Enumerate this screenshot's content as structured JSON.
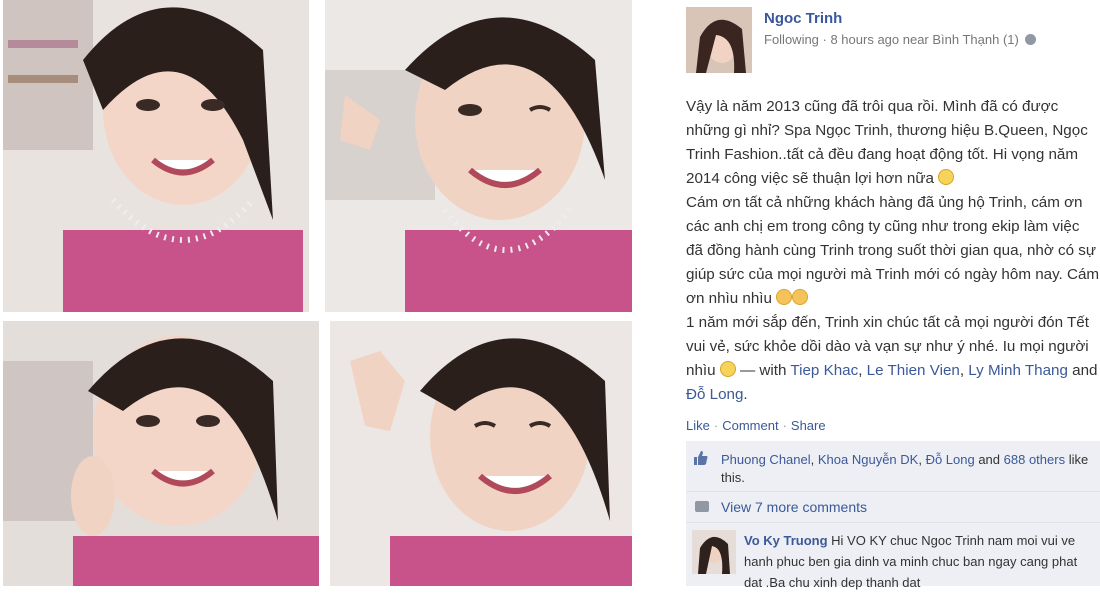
{
  "post": {
    "author": "Ngoc Trinh",
    "meta": "Following · 8 hours ago near Bình Thạnh (1)",
    "text": {
      "p1": "Vậy là năm 2013 cũng đã trôi qua rồi. Mình đã có được những gì nhỉ? Spa Ngọc Trinh, thương hiệu B.Queen, Ngọc Trinh Fashion..tất cả đều đang hoạt động tốt. Hi vọng năm 2014 công việc sẽ thuận lợi hơn nữa",
      "p2": "Cám ơn tất cả những khách hàng đã ủng hộ Trinh, cám ơn các anh chị em trong công ty cũng như trong ekip làm việc đã đồng hành cùng Trinh trong suốt thời gian qua, nhờ có sự giúp sức của mọi người mà Trinh mới có ngày hôm nay. Cám ơn nhìu nhìu",
      "p3": "1 năm mới sắp đến, Trinh xin chúc tất cả mọi người đón Tết vui vẻ, sức khỏe dồi dào và vạn sự như ý nhé. Iu mọi người nhìu",
      "with_prefix": " — with ",
      "tag1": "Tiep Khac",
      "comma1": ", ",
      "tag2": "Le Thien Vien",
      "comma2": ", ",
      "tag3": "Ly Minh Thang",
      "and_word": " and ",
      "tag4": "Đỗ Long",
      "period": "."
    },
    "actions": {
      "like": "Like",
      "comment": "Comment",
      "share": "Share",
      "sep": "·"
    },
    "likes": {
      "name1": "Phuong Chanel",
      "sep1": ", ",
      "name2": "Khoa Nguyễn DK",
      "sep2": ", ",
      "name3": "Đỗ Long",
      "and_word": " and ",
      "others": "688 others",
      "suffix": " like this."
    },
    "view_more": "View 7 more comments",
    "comment": {
      "author": "Vo Ky Truong",
      "text": " Hi VO KY chuc Ngoc Trinh nam moi vui ve hanh phuc ben gia dinh va minh chuc ban ngay cang phat dat .Ba chu xinh dep thanh dat"
    }
  },
  "colors": {
    "link": "#3b5998",
    "panel": "#edeff4",
    "dress": "#c8528a"
  }
}
